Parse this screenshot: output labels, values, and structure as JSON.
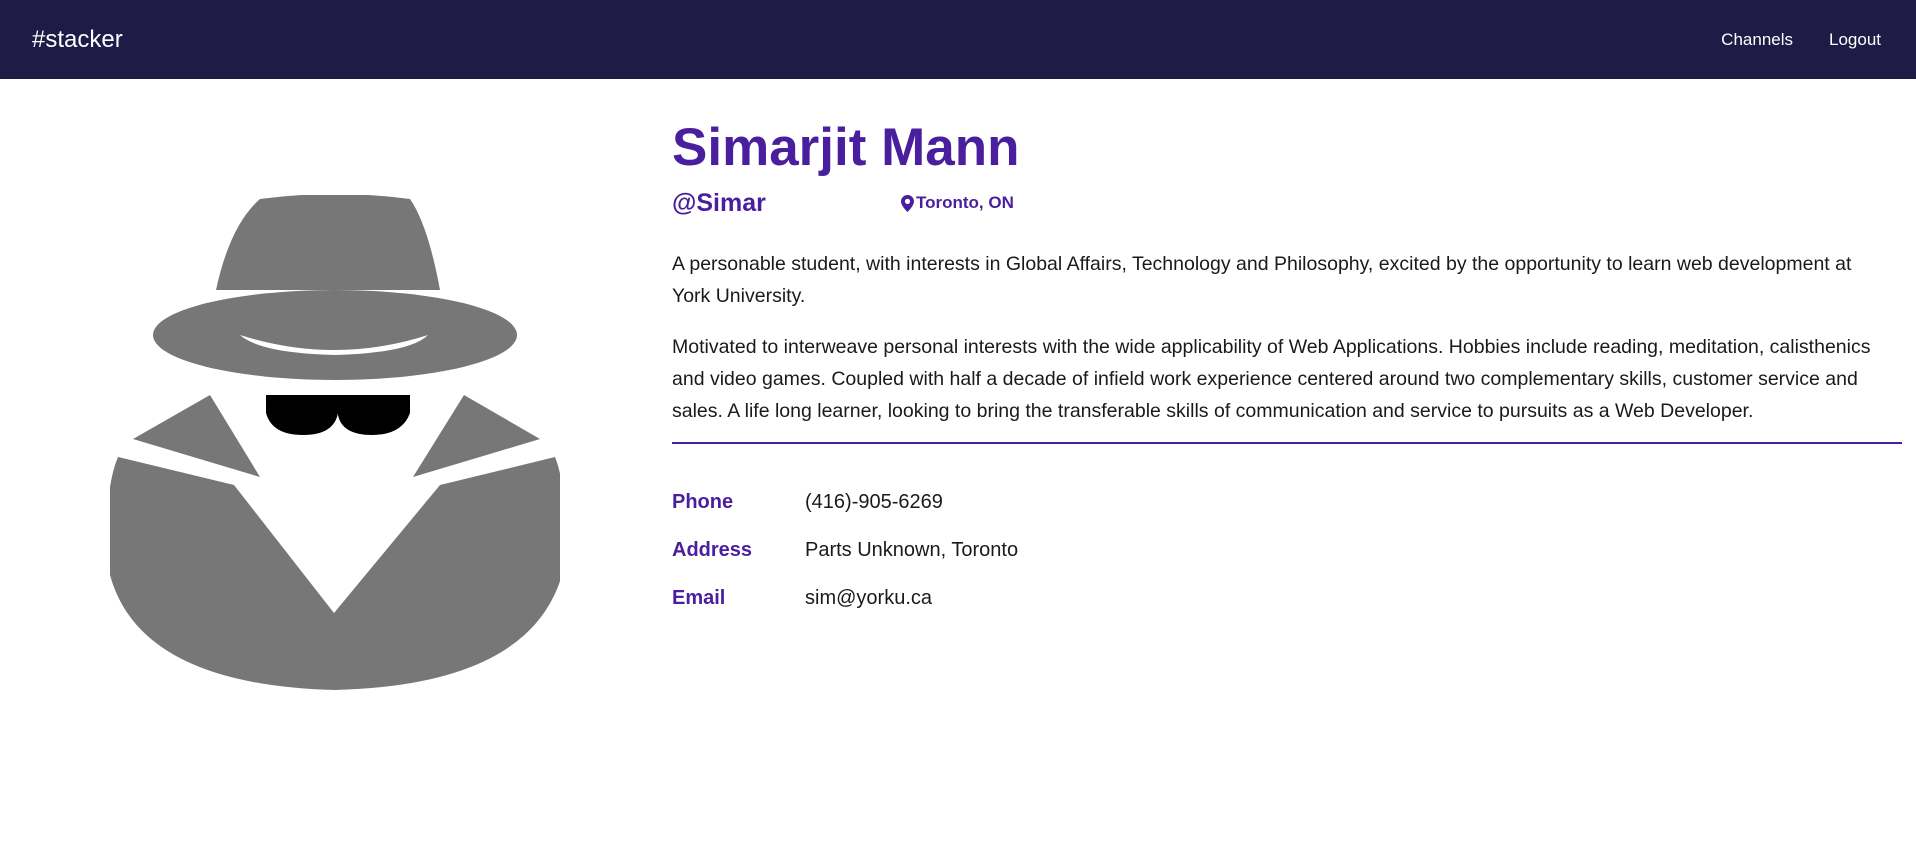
{
  "navbar": {
    "brand": "#stacker",
    "links": [
      "Channels",
      "Logout"
    ]
  },
  "avatar": {
    "icon": "spy-incognito-icon",
    "fill_color": "#777777"
  },
  "profile": {
    "name": "Simarjit Mann",
    "handle": "@Simar",
    "location": "Toronto, ON",
    "bio": [
      "A personable student, with interests in Global Affairs, Technology and Philosophy, excited by the opportunity to learn web development at York University.",
      "Motivated to interweave personal interests with the wide applicability of Web Applications. Hobbies include reading, meditation, calisthenics and video games. Coupled with half a decade of infield work experience centered around two complementary skills, customer service and sales. A life long learner, looking to bring the transferable skills of communication and service to pursuits as a Web Developer."
    ],
    "contact": [
      {
        "label": "Phone",
        "value": "(416)-905-6269"
      },
      {
        "label": "Address",
        "value": "Parts Unknown, Toronto"
      },
      {
        "label": "Email",
        "value": "sim@yorku.ca"
      }
    ]
  },
  "colors": {
    "navbar_bg": "#1e1b47",
    "accent": "#4a1f9d",
    "text": "#1a1a1a"
  }
}
